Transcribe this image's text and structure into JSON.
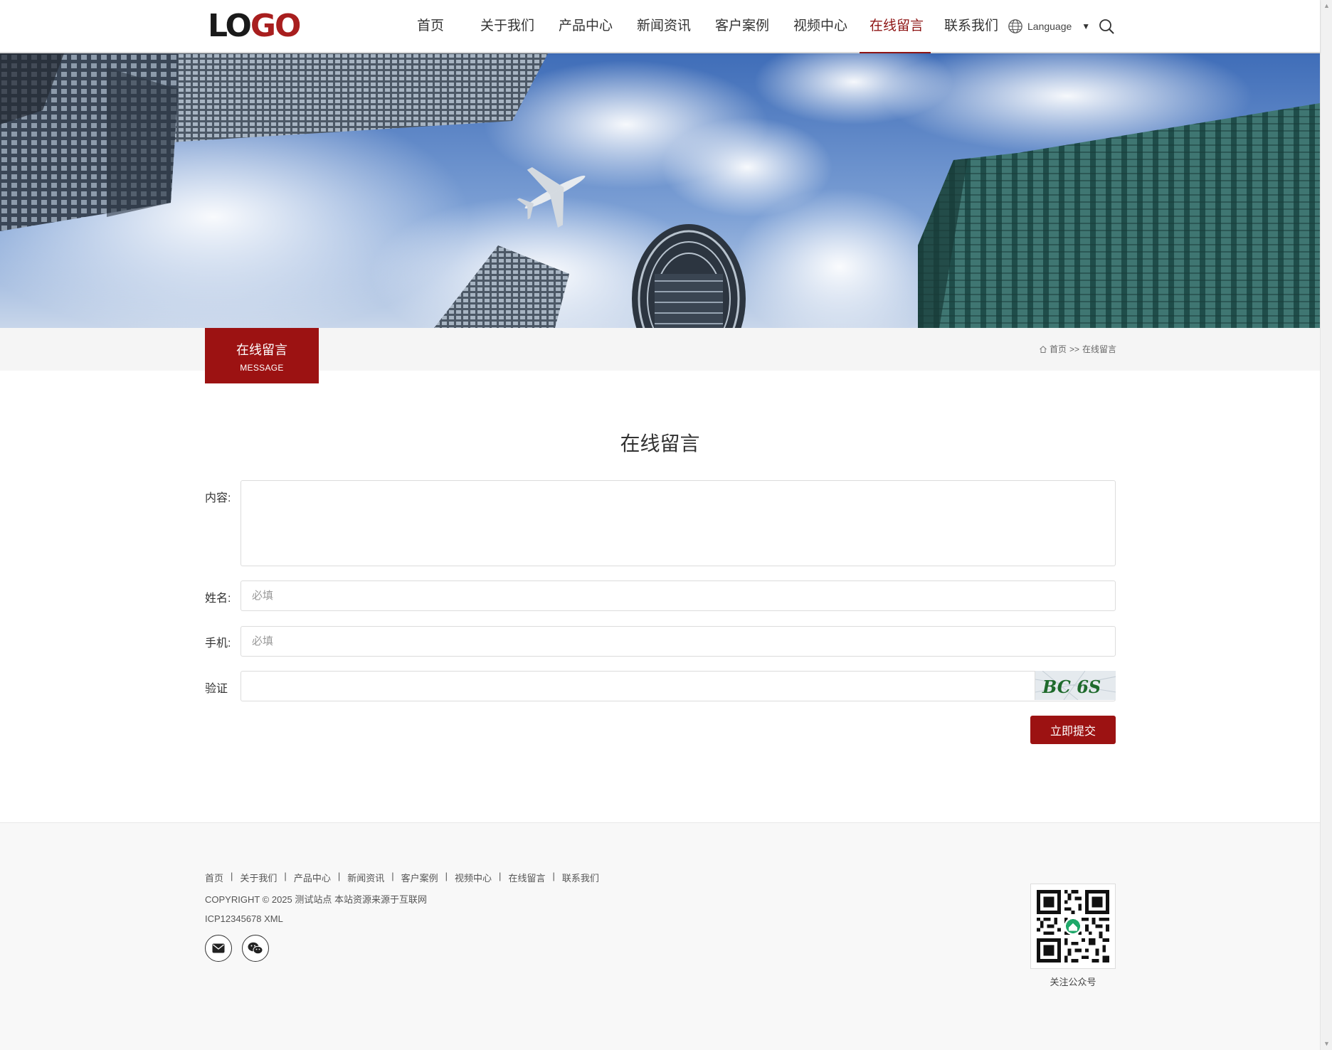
{
  "header": {
    "logo_left": "LO",
    "logo_right": "GO",
    "nav": [
      {
        "label": "首页"
      },
      {
        "label": "关于我们"
      },
      {
        "label": "产品中心"
      },
      {
        "label": "新闻资讯"
      },
      {
        "label": "客户案例"
      },
      {
        "label": "视频中心"
      },
      {
        "label": "在线留言",
        "active": true
      },
      {
        "label": "联系我们"
      }
    ],
    "language_label": "Language",
    "language_caret": "▼"
  },
  "section": {
    "title_cn": "在线留言",
    "title_en": "MESSAGE"
  },
  "breadcrumb": {
    "home": "首页",
    "separator": ">>",
    "current": "在线留言"
  },
  "form": {
    "title": "在线留言",
    "content_label": "内容:",
    "name_label": "姓名:",
    "name_placeholder": "必填",
    "phone_label": "手机:",
    "phone_placeholder": "必填",
    "captcha_label": "验证",
    "captcha_text": "BC 6S",
    "submit_label": "立即提交"
  },
  "footer": {
    "nav": [
      "首页",
      "关于我们",
      "产品中心",
      "新闻资讯",
      "客户案例",
      "视频中心",
      "在线留言",
      "联系我们"
    ],
    "copyright": "COPYRIGHT © 2025 测试站点 本站资源来源于互联网",
    "icp": "ICP12345678 XML",
    "qr_label": "关注公众号"
  },
  "colors": {
    "brand": "#9c1212",
    "nav_active": "#8e1515"
  }
}
